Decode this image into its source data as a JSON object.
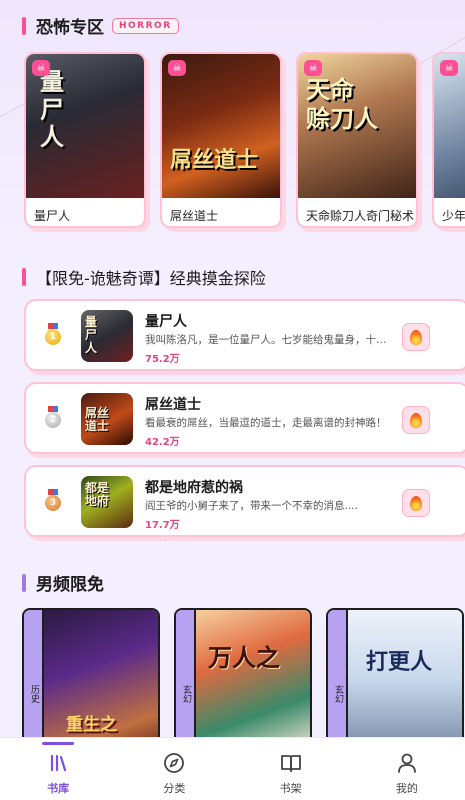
{
  "sections": {
    "horror": {
      "title": "恐怖专区",
      "badge": "HORROR"
    },
    "ranking": {
      "title": "【限免-诡魅奇谭】经典摸金探险"
    },
    "male": {
      "title": "男频限免"
    }
  },
  "horror_books": [
    {
      "name": "量尸人",
      "cover_text": "量\n尸\n人"
    },
    {
      "name": "屌丝道士",
      "cover_text": "屌丝道士"
    },
    {
      "name": "天命赊刀人奇门秘术",
      "cover_text": "天命\n赊刀人"
    },
    {
      "name": "少年",
      "cover_text": ""
    }
  ],
  "ranking_items": [
    {
      "rank": "1",
      "title": "量尸人",
      "desc": "我叫陈洛凡，是一位量尸人。七岁能给鬼量身，十八...",
      "count": "75.2万",
      "thumb": "量\n尸\n人"
    },
    {
      "rank": "2",
      "title": "屌丝道士",
      "desc": "看最衰的屌丝，当最逗的道士，走最离谱的封神路！",
      "count": "42.2万",
      "thumb": "屌丝\n道士"
    },
    {
      "rank": "3",
      "title": "都是地府惹的祸",
      "desc": "阎王爷的小舅子来了，带来一个不幸的消息....",
      "count": "17.7万",
      "thumb": "都是\n地府"
    }
  ],
  "male_books": [
    {
      "tag": "历史",
      "cover_text": "重生之"
    },
    {
      "tag": "玄幻",
      "cover_text": "万人之"
    },
    {
      "tag": "玄幻",
      "cover_text": "打更人"
    }
  ],
  "tabs": [
    {
      "label": "书库",
      "icon": "library-icon",
      "active": true
    },
    {
      "label": "分类",
      "icon": "compass-icon",
      "active": false
    },
    {
      "label": "书架",
      "icon": "book-open-icon",
      "active": false
    },
    {
      "label": "我的",
      "icon": "user-icon",
      "active": false
    }
  ],
  "colors": {
    "accent_pink": "#ff4f93",
    "accent_purple": "#7b4fe0",
    "background": "#f4efff"
  }
}
